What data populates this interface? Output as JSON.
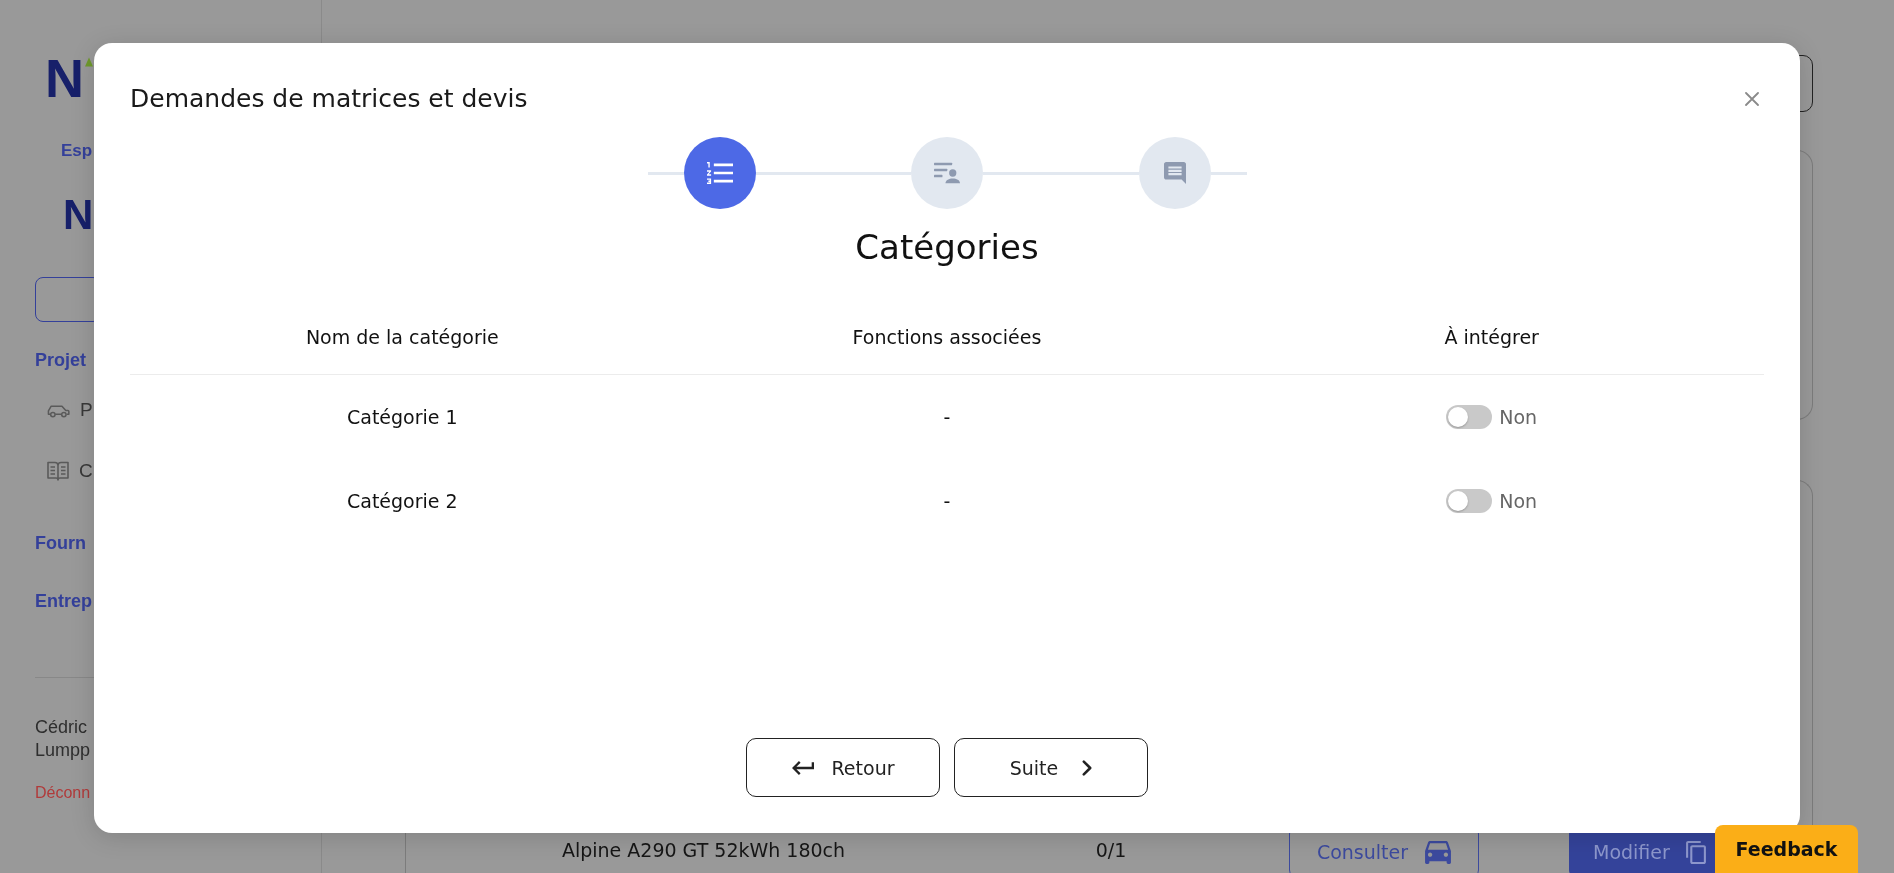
{
  "sidebar": {
    "logo": "N",
    "space_label": "Esp",
    "brand": "N",
    "nav": [
      {
        "label": "Projet",
        "children": [
          {
            "label": "P"
          },
          {
            "label": "C"
          }
        ]
      },
      {
        "label": "Fourn"
      },
      {
        "label": "Entrep"
      }
    ],
    "user": {
      "name": "Cédric Lumpp",
      "logout": "Déconn"
    }
  },
  "projects_table": {
    "rows": [
      {
        "cells": [
          "Alpine A290 GT 52kWh 180ch",
          "0/1"
        ],
        "buttons": [
          {
            "label": "Consulter",
            "kind": "outline"
          },
          {
            "label": "Modifier",
            "kind": "filled"
          }
        ]
      }
    ]
  },
  "feedback_button": {
    "label": "Feedback"
  },
  "modal": {
    "title": "Demandes de matrices et devis",
    "steps": [
      {
        "selected": true
      },
      {
        "selected": false
      },
      {
        "selected": false
      }
    ],
    "step_title": "Catégories",
    "table": {
      "columns": [
        "Nom de la catégorie",
        "Fonctions associées",
        "À intégrer"
      ],
      "rows": [
        {
          "name": "Catégorie 1",
          "functions": "-",
          "integrate": {
            "on": false,
            "label": "Non"
          }
        },
        {
          "name": "Catégorie 2",
          "functions": "-",
          "integrate": {
            "on": false,
            "label": "Non"
          }
        }
      ]
    },
    "buttons": [
      {
        "label": "Retour",
        "kind": "back"
      },
      {
        "label": "Suite",
        "kind": "next"
      }
    ]
  }
}
